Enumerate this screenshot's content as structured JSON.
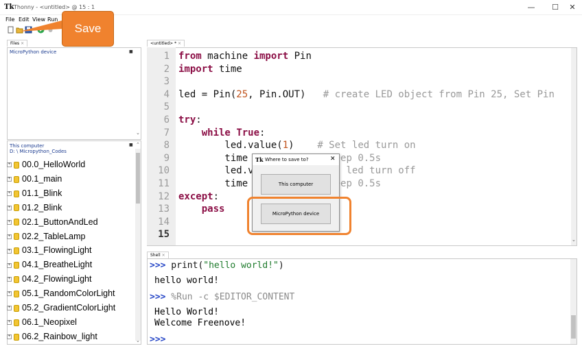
{
  "window": {
    "title": "Thonny - <untitled> @ 15 : 1",
    "app_icon": "Tk",
    "minimize": "—",
    "maximize": "☐",
    "close": "✕"
  },
  "menu": [
    "File",
    "Edit",
    "View",
    "Run"
  ],
  "toolbar": {
    "icons": [
      "new-file-icon",
      "open-file-icon",
      "save-icon",
      "run-icon",
      "debug-icon"
    ]
  },
  "files_panel": {
    "tab_label": "Files",
    "tab_close": "×",
    "device_label": "MicroPython device",
    "computer_label": "This computer",
    "computer_path": "D: \\ Micropython_Codes",
    "items": [
      "00.0_HelloWorld",
      "00.1_main",
      "01.1_Blink",
      "01.2_Blink",
      "02.1_ButtonAndLed",
      "02.2_TableLamp",
      "03.1_FlowingLight",
      "04.1_BreatheLight",
      "04.2_FlowingLight",
      "05.1_RandomColorLight",
      "05.2_GradientColorLight",
      "06.1_Neopixel",
      "06.2_Rainbow_light"
    ]
  },
  "editor": {
    "tab_label": "<untitled> *",
    "tab_close": "×",
    "line_numbers": [
      "1",
      "2",
      "3",
      "4",
      "5",
      "6",
      "7",
      "8",
      "9",
      "10",
      "11",
      "12",
      "13",
      "14",
      "15"
    ],
    "lines": [
      [
        {
          "t": "kw",
          "v": "from"
        },
        {
          "t": "txt",
          "v": " machine "
        },
        {
          "t": "kw",
          "v": "import"
        },
        {
          "t": "txt",
          "v": " Pin"
        }
      ],
      [
        {
          "t": "kw",
          "v": "import"
        },
        {
          "t": "txt",
          "v": " time"
        }
      ],
      [],
      [
        {
          "t": "txt",
          "v": "led = Pin("
        },
        {
          "t": "num",
          "v": "25"
        },
        {
          "t": "txt",
          "v": ", Pin.OUT)   "
        },
        {
          "t": "com",
          "v": "# create LED object from Pin 25, Set Pin"
        }
      ],
      [],
      [
        {
          "t": "kw",
          "v": "try"
        },
        {
          "t": "txt",
          "v": ":"
        }
      ],
      [
        {
          "t": "txt",
          "v": "    "
        },
        {
          "t": "kw",
          "v": "while"
        },
        {
          "t": "txt",
          "v": " "
        },
        {
          "t": "kw",
          "v": "True"
        },
        {
          "t": "txt",
          "v": ":"
        }
      ],
      [
        {
          "t": "txt",
          "v": "        led.value("
        },
        {
          "t": "num",
          "v": "1"
        },
        {
          "t": "txt",
          "v": ")    "
        },
        {
          "t": "com",
          "v": "# Set led turn on"
        }
      ],
      [
        {
          "t": "txt",
          "v": "        time"
        },
        {
          "t": "txt",
          "v": "              "
        },
        {
          "t": "com",
          "v": "leep 0.5s"
        }
      ],
      [
        {
          "t": "txt",
          "v": "        led.v"
        },
        {
          "t": "txt",
          "v": "             "
        },
        {
          "t": "com",
          "v": "et led turn off"
        }
      ],
      [
        {
          "t": "txt",
          "v": "        time"
        },
        {
          "t": "txt",
          "v": "              "
        },
        {
          "t": "com",
          "v": "leep 0.5s"
        }
      ],
      [
        {
          "t": "kw",
          "v": "except"
        },
        {
          "t": "txt",
          "v": ":"
        }
      ],
      [
        {
          "t": "txt",
          "v": "    "
        },
        {
          "t": "kw",
          "v": "pass"
        }
      ],
      [],
      []
    ]
  },
  "shell": {
    "tab_label": "Shell",
    "tab_close": "×",
    "prompt": ">>>",
    "cmd1_fn": " print(",
    "cmd1_str": "\"hello world!\"",
    "cmd1_end": ")",
    "out1": "hello world!",
    "cmd2": " %Run -c $EDITOR_CONTENT",
    "out2a": "Hello World!",
    "out2b": "Welcome Freenove!"
  },
  "dialog": {
    "icon": "Tk",
    "title": "Where to save to?",
    "close": "✕",
    "btn_computer": "This computer",
    "btn_device": "MicroPython device"
  },
  "annotation": {
    "save_label": "Save"
  },
  "colors": {
    "accent_orange": "#f0822e",
    "keyword": "#8b0e45",
    "number": "#c0521b",
    "comment": "#999999",
    "prompt": "#2848c7"
  }
}
